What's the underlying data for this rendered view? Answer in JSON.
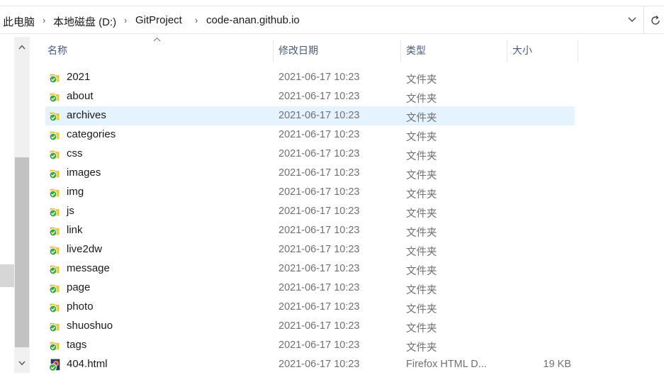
{
  "breadcrumb": {
    "items": [
      "此电脑",
      "本地磁盘 (D:)",
      "GitProject",
      "code-anan.github.io"
    ],
    "separator": "›"
  },
  "address_bar": {
    "dropdown_icon": "chevron-down-icon",
    "refresh_icon": "refresh-icon"
  },
  "columns": {
    "name": "名称",
    "modified": "修改日期",
    "type": "类型",
    "size": "大小"
  },
  "files": [
    {
      "name": "2021",
      "modified": "2021-06-17 10:23",
      "type": "文件夹",
      "size": "",
      "icon": "folder-synced-icon"
    },
    {
      "name": "about",
      "modified": "2021-06-17 10:23",
      "type": "文件夹",
      "size": "",
      "icon": "folder-synced-icon"
    },
    {
      "name": "archives",
      "modified": "2021-06-17 10:23",
      "type": "文件夹",
      "size": "",
      "icon": "folder-synced-icon",
      "selected": true
    },
    {
      "name": "categories",
      "modified": "2021-06-17 10:23",
      "type": "文件夹",
      "size": "",
      "icon": "folder-synced-icon"
    },
    {
      "name": "css",
      "modified": "2021-06-17 10:23",
      "type": "文件夹",
      "size": "",
      "icon": "folder-synced-icon"
    },
    {
      "name": "images",
      "modified": "2021-06-17 10:23",
      "type": "文件夹",
      "size": "",
      "icon": "folder-synced-icon"
    },
    {
      "name": "img",
      "modified": "2021-06-17 10:23",
      "type": "文件夹",
      "size": "",
      "icon": "folder-synced-icon"
    },
    {
      "name": "js",
      "modified": "2021-06-17 10:23",
      "type": "文件夹",
      "size": "",
      "icon": "folder-synced-icon"
    },
    {
      "name": "link",
      "modified": "2021-06-17 10:23",
      "type": "文件夹",
      "size": "",
      "icon": "folder-synced-icon"
    },
    {
      "name": "live2dw",
      "modified": "2021-06-17 10:23",
      "type": "文件夹",
      "size": "",
      "icon": "folder-synced-icon"
    },
    {
      "name": "message",
      "modified": "2021-06-17 10:23",
      "type": "文件夹",
      "size": "",
      "icon": "folder-synced-icon"
    },
    {
      "name": "page",
      "modified": "2021-06-17 10:23",
      "type": "文件夹",
      "size": "",
      "icon": "folder-synced-icon"
    },
    {
      "name": "photo",
      "modified": "2021-06-17 10:23",
      "type": "文件夹",
      "size": "",
      "icon": "folder-synced-icon"
    },
    {
      "name": "shuoshuo",
      "modified": "2021-06-17 10:23",
      "type": "文件夹",
      "size": "",
      "icon": "folder-synced-icon"
    },
    {
      "name": "tags",
      "modified": "2021-06-17 10:23",
      "type": "文件夹",
      "size": "",
      "icon": "folder-synced-icon"
    },
    {
      "name": "404.html",
      "modified": "2021-06-17 10:23",
      "type": "Firefox HTML D...",
      "size": "19 KB",
      "icon": "html-file-synced-icon"
    }
  ],
  "colors": {
    "selection": "#e5f3ff",
    "header_text": "#4a5a7a",
    "sync_green": "#3aa83a",
    "folder_yellow": "#f5c842"
  }
}
